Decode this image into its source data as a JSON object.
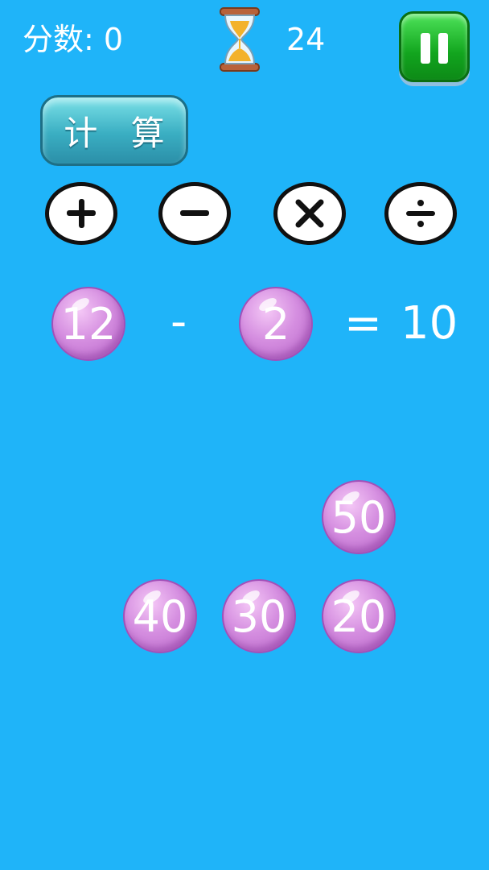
{
  "header": {
    "score_label": "分数:",
    "score_value": "0",
    "timer_value": "24",
    "hourglass_icon": "hourglass-icon",
    "pause_icon": "pause-icon"
  },
  "compute_button": {
    "label": "计 算"
  },
  "operators": [
    {
      "symbol": "+",
      "icon": "plus-icon"
    },
    {
      "symbol": "−",
      "icon": "minus-icon"
    },
    {
      "symbol": "×",
      "icon": "multiply-icon"
    },
    {
      "symbol": "÷",
      "icon": "divide-icon"
    }
  ],
  "equation": {
    "left_operand": "12",
    "operator": "-",
    "right_operand": "2",
    "equals": "=",
    "result": "10"
  },
  "number_bubbles": [
    "50",
    "40",
    "30",
    "20"
  ],
  "colors": {
    "background": "#1fb4f9",
    "bubble": "#d58ee0",
    "pause_button": "#12a51e",
    "compute_button": "#3aaec2"
  }
}
